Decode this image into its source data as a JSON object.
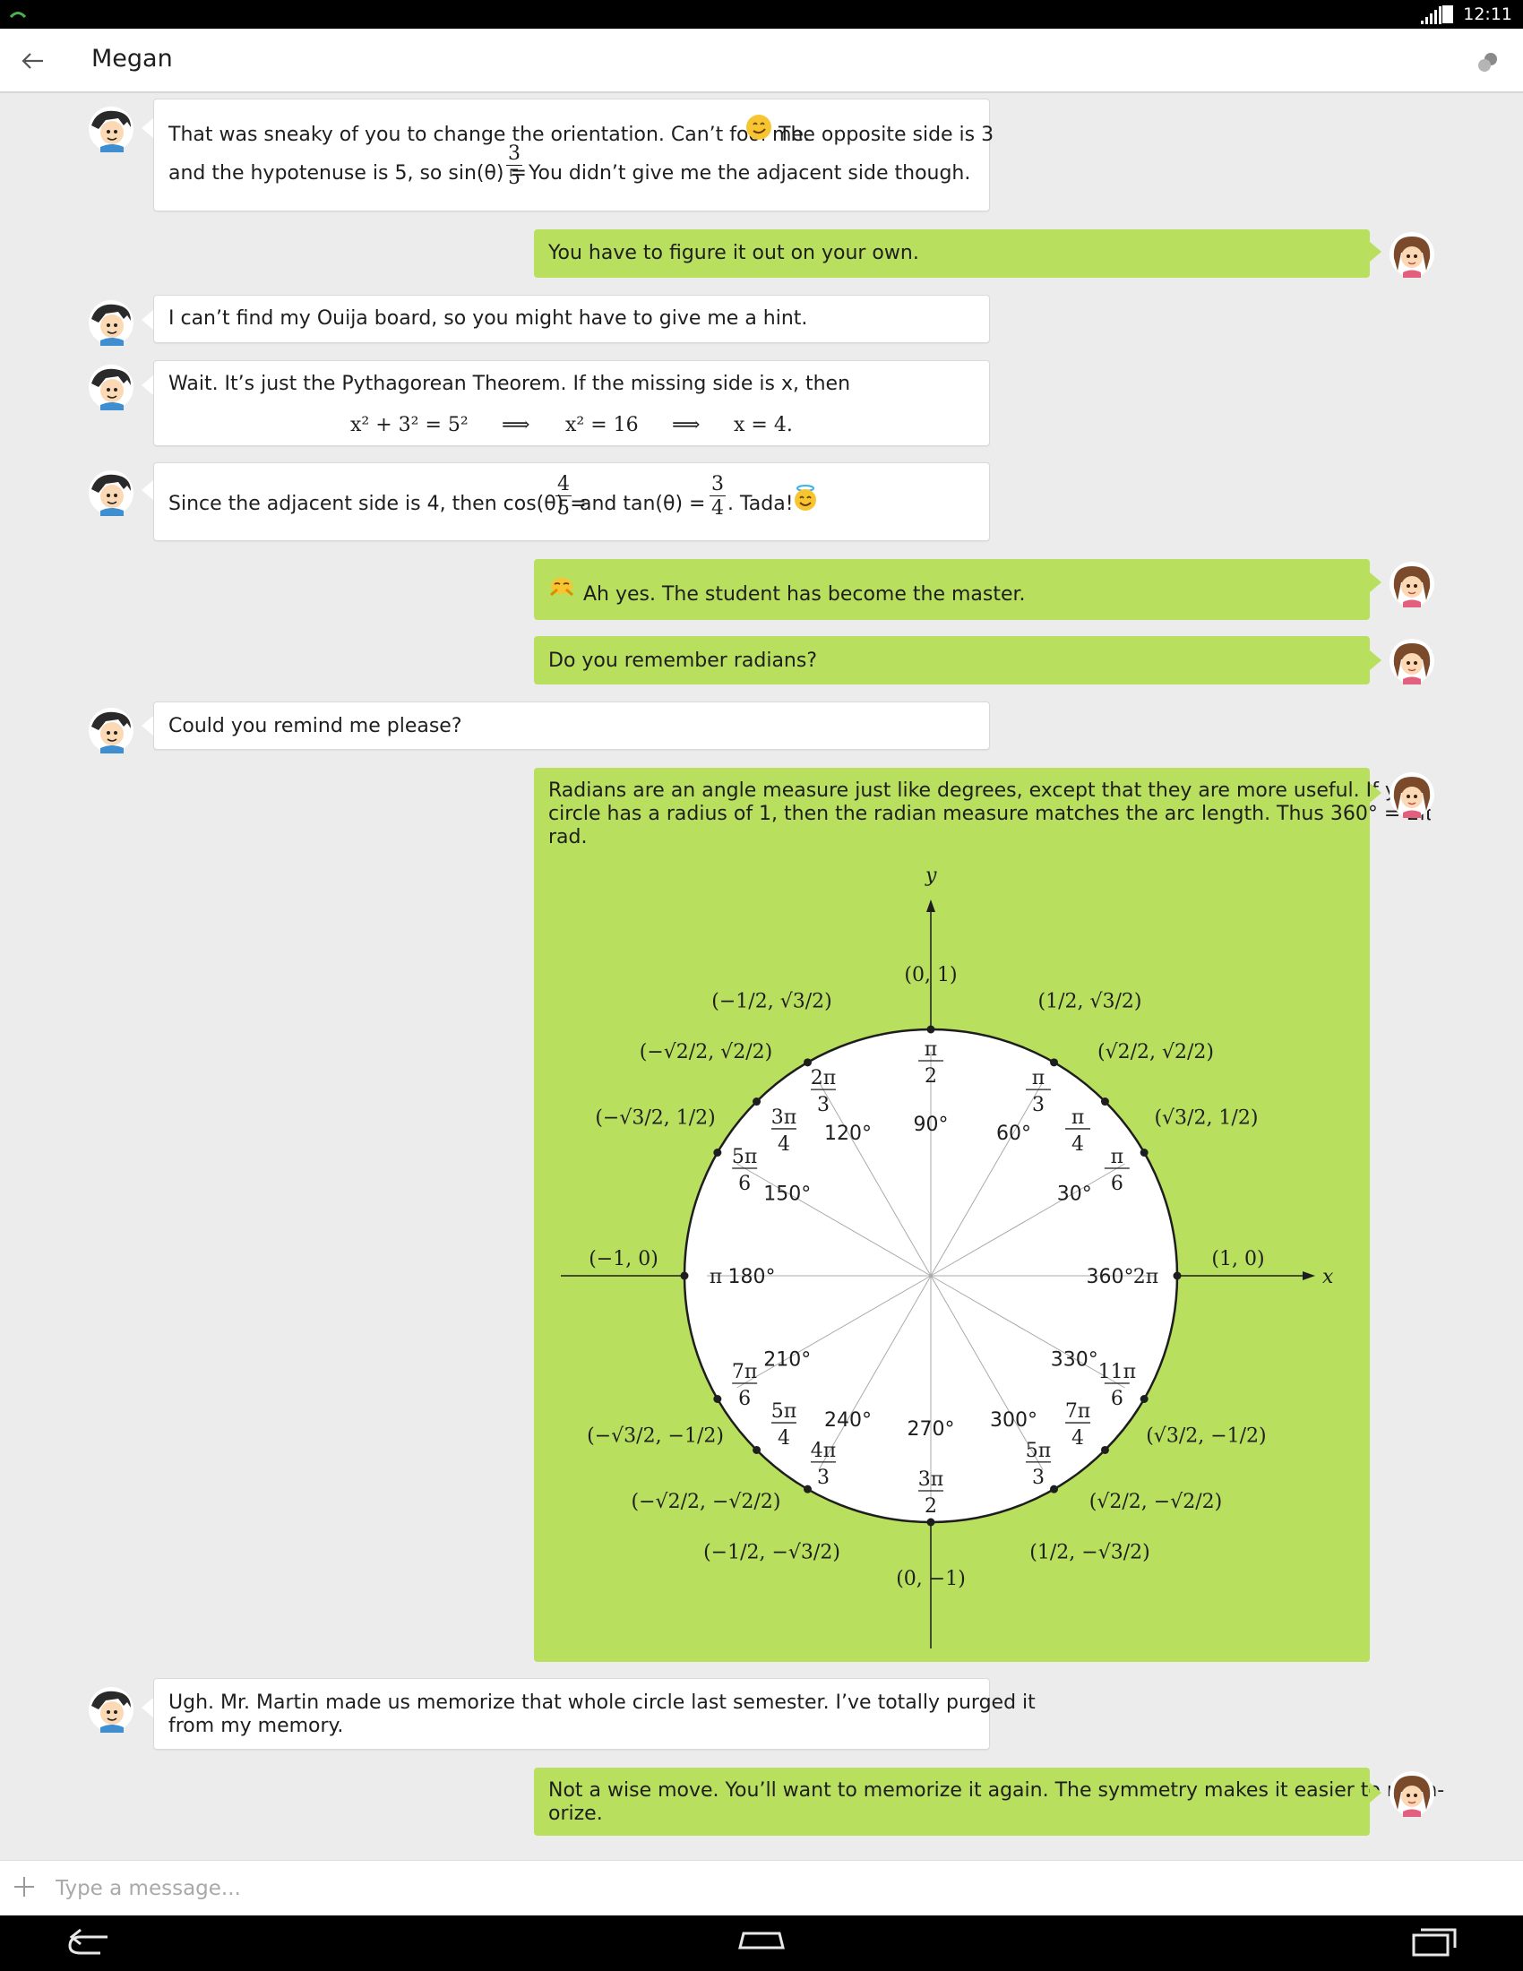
{
  "status_bar": {
    "time": "12:11"
  },
  "app_bar": {
    "title": "Megan"
  },
  "messages": [
    {
      "lines": [
        "That was sneaky of you to change the orientation. Can’t fool me.",
        "The opposite side is 3",
        "and the hypotenuse is 5, so sin(θ) =",
        "You didn’t give me the adjacent side though."
      ],
      "frac": {
        "n": "3",
        "d": "5"
      }
    },
    {
      "text": "You have to figure it out on your own."
    },
    {
      "text": "I can’t find my Ouija board, so you might have to give me a hint."
    },
    {
      "lines": [
        "Wait. It’s just the Pythagorean Theorem. If the missing side is x, then"
      ],
      "math": [
        "x² + 3² = 5²",
        "⟹",
        "x² = 16",
        "⟹",
        "x = 4."
      ]
    },
    {
      "lines": [
        "Since the adjacent side is 4, then cos(θ) =",
        "and tan(θ) =",
        ". Tada!"
      ],
      "frac1": {
        "n": "4",
        "d": "5"
      },
      "frac2": {
        "n": "3",
        "d": "4"
      }
    },
    {
      "text": "Ah yes. The student has become the master."
    },
    {
      "text": "Do you remember radians?"
    },
    {
      "text": "Could you remind me please?"
    },
    {
      "lines": [
        "Radians are an angle measure just like degrees, except that they are more useful. If your",
        "circle has a radius of 1, then the radian measure matches the arc length. Thus 360° = 2π",
        "rad."
      ]
    },
    {
      "lines": [
        "Ugh. Mr. Martin made us memorize that whole circle last semester. I’ve totally purged it",
        "from my memory."
      ]
    },
    {
      "lines": [
        "Not a wise move. You’ll want to memorize it again. The symmetry makes it easier to mem-",
        "orize."
      ]
    }
  ],
  "unit_circle": {
    "axis_x_label": "x",
    "axis_y_label": "y",
    "points": [
      {
        "deg": "360°",
        "rad": "2π",
        "coord": "(1, 0)"
      },
      {
        "deg": "30°",
        "rad_n": "π",
        "rad_d": "6",
        "coord": "(√3/2, 1/2)"
      },
      {
        "deg": "60°",
        "rad_n": "π",
        "rad_d": "3",
        "coord": "(1/2, √3/2)"
      },
      {
        "deg": "90°",
        "rad_n": "π",
        "rad_d": "2",
        "coord": "(0, 1)"
      },
      {
        "deg": "120°",
        "rad_n": "2π",
        "rad_d": "3",
        "coord": "(−1/2, √3/2)"
      },
      {
        "deg": "150°",
        "rad_n": "5π",
        "rad_d": "6",
        "coord": "(−√3/2, 1/2)"
      },
      {
        "deg": "180°",
        "rad": "π",
        "coord": "(−1, 0)"
      },
      {
        "deg": "210°",
        "rad_n": "7π",
        "rad_d": "6",
        "coord": "(−√3/2, −1/2)"
      },
      {
        "deg": "240°",
        "rad_n": "4π",
        "rad_d": "3",
        "coord": "(−1/2, −√3/2)"
      },
      {
        "deg": "270°",
        "rad_n": "3π",
        "rad_d": "2",
        "coord": "(0, −1)"
      },
      {
        "deg": "300°",
        "rad_n": "5π",
        "rad_d": "3",
        "coord": "(1/2, −√3/2)"
      },
      {
        "deg": "330°",
        "rad_n": "11π",
        "rad_d": "6",
        "coord": "(√3/2, −1/2)"
      },
      {
        "rad_n": "π",
        "rad_d": "4",
        "coord": "(√2/2, √2/2)"
      },
      {
        "rad_n": "3π",
        "rad_d": "4",
        "coord": "(−√2/2, √2/2)"
      },
      {
        "rad_n": "5π",
        "rad_d": "4",
        "coord": "(−√2/2, −√2/2)"
      },
      {
        "rad_n": "7π",
        "rad_d": "4",
        "coord": "(√2/2, −√2/2)"
      }
    ]
  },
  "composer": {
    "placeholder": "Type a message..."
  },
  "icons": [
    "back-arrow-icon",
    "more-icon",
    "plus-icon",
    "nav-back-icon",
    "nav-home-icon",
    "nav-recents-icon",
    "signal-icon",
    "battery-icon"
  ],
  "colors": {
    "outgoing_bubble": "#b8df5d",
    "incoming_bubble": "#ffffff",
    "background": "#ececec"
  }
}
